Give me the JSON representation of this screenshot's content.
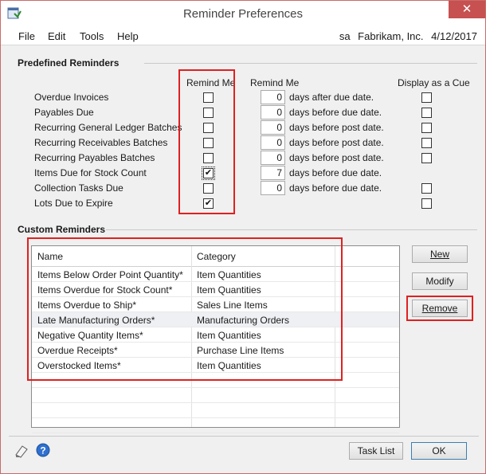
{
  "window": {
    "title": "Reminder Preferences",
    "close_glyph": "✕"
  },
  "menu": {
    "items": [
      "File",
      "Edit",
      "Tools",
      "Help"
    ]
  },
  "status": {
    "user": "sa",
    "company": "Fabrikam, Inc.",
    "date": "4/12/2017"
  },
  "predefined": {
    "section_title": "Predefined Reminders",
    "col_remind_me": "Remind Me",
    "col_remind_me_days": "Remind Me",
    "col_display_cue": "Display as a Cue",
    "rows": [
      {
        "label": "Overdue Invoices",
        "remind": false,
        "days": "0",
        "days_text": "days after due date.",
        "cue": false
      },
      {
        "label": "Payables Due",
        "remind": false,
        "days": "0",
        "days_text": "days before due date.",
        "cue": false
      },
      {
        "label": "Recurring General Ledger Batches",
        "remind": false,
        "days": "0",
        "days_text": "days before post date.",
        "cue": false
      },
      {
        "label": "Recurring Receivables Batches",
        "remind": false,
        "days": "0",
        "days_text": "days before post date.",
        "cue": false
      },
      {
        "label": "Recurring Payables Batches",
        "remind": false,
        "days": "0",
        "days_text": "days before post date.",
        "cue": false
      },
      {
        "label": "Items Due for Stock Count",
        "remind": true,
        "days": "7",
        "days_text": "days before due date.",
        "cue": null
      },
      {
        "label": "Collection Tasks Due",
        "remind": false,
        "days": "0",
        "days_text": "days before due date.",
        "cue": false
      },
      {
        "label": "Lots Due to Expire",
        "remind": true,
        "days": null,
        "days_text": null,
        "cue": false
      }
    ]
  },
  "custom": {
    "section_title": "Custom Reminders",
    "col_name": "Name",
    "col_category": "Category",
    "rows": [
      {
        "name": "Items Below Order Point Quantity*",
        "category": "Item Quantities"
      },
      {
        "name": "Items Overdue for Stock Count*",
        "category": "Item Quantities"
      },
      {
        "name": "Items Overdue to Ship*",
        "category": "Sales Line Items"
      },
      {
        "name": "Late Manufacturing Orders*",
        "category": "Manufacturing Orders"
      },
      {
        "name": "Negative Quantity Items*",
        "category": "Item Quantities"
      },
      {
        "name": "Overdue Receipts*",
        "category": "Purchase Line Items"
      },
      {
        "name": "Overstocked Items*",
        "category": "Item Quantities"
      }
    ]
  },
  "buttons": {
    "new": "New",
    "modify": "Modify",
    "remove": "Remove",
    "task_list": "Task List",
    "ok": "OK"
  },
  "icons": {
    "app": "reminder-window-icon",
    "note": "note-pencil-icon",
    "help": "help-question-icon"
  },
  "colors": {
    "highlight_box": "#e02020",
    "close_button": "#c75050",
    "menubar_bg": "#ffffff"
  },
  "check_glyph": "✔"
}
